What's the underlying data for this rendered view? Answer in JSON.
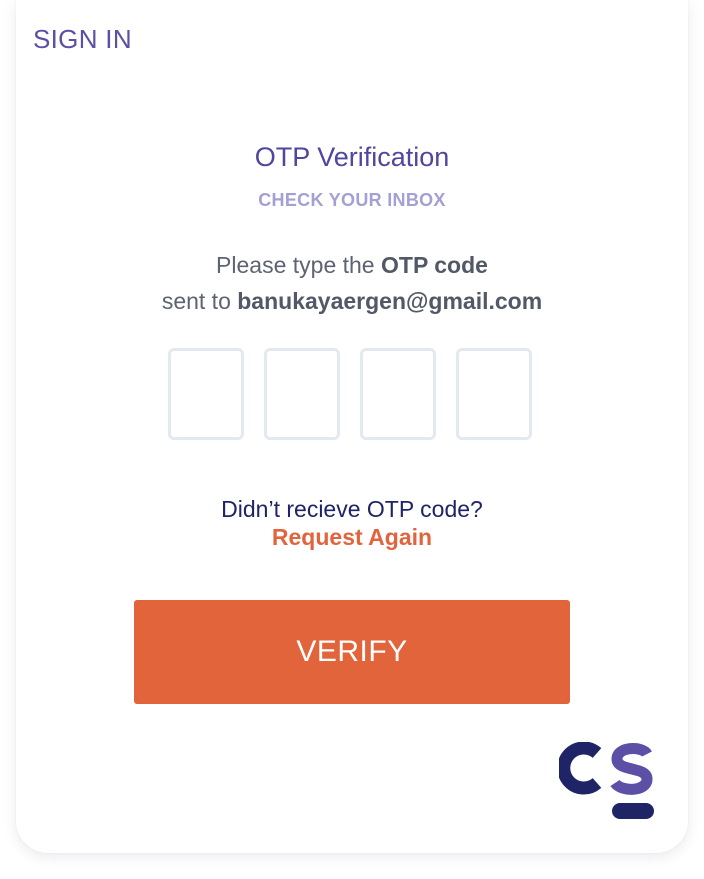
{
  "header": {
    "sign_in_label": "SIGN IN"
  },
  "otp": {
    "title": "OTP Verification",
    "subtitle": "CHECK YOUR INBOX",
    "instruction_prefix": "Please type the ",
    "instruction_bold": "OTP code",
    "sent_to_prefix": "sent to ",
    "email": "banukayaergen@gmail.com",
    "digits": [
      "",
      "",
      "",
      ""
    ]
  },
  "resend": {
    "question": "Didn’t recieve OTP code?",
    "link_label": "Request Again"
  },
  "verify_button": {
    "label": "VERIFY"
  },
  "logo": {
    "name": "cs-logo",
    "text": "CS"
  },
  "colors": {
    "accent_orange": "#e2643b",
    "brand_purple": "#5b4fa6",
    "navy": "#1f2467",
    "subtitle_lavender": "#a49fd4",
    "input_border": "#e3e9f1"
  }
}
